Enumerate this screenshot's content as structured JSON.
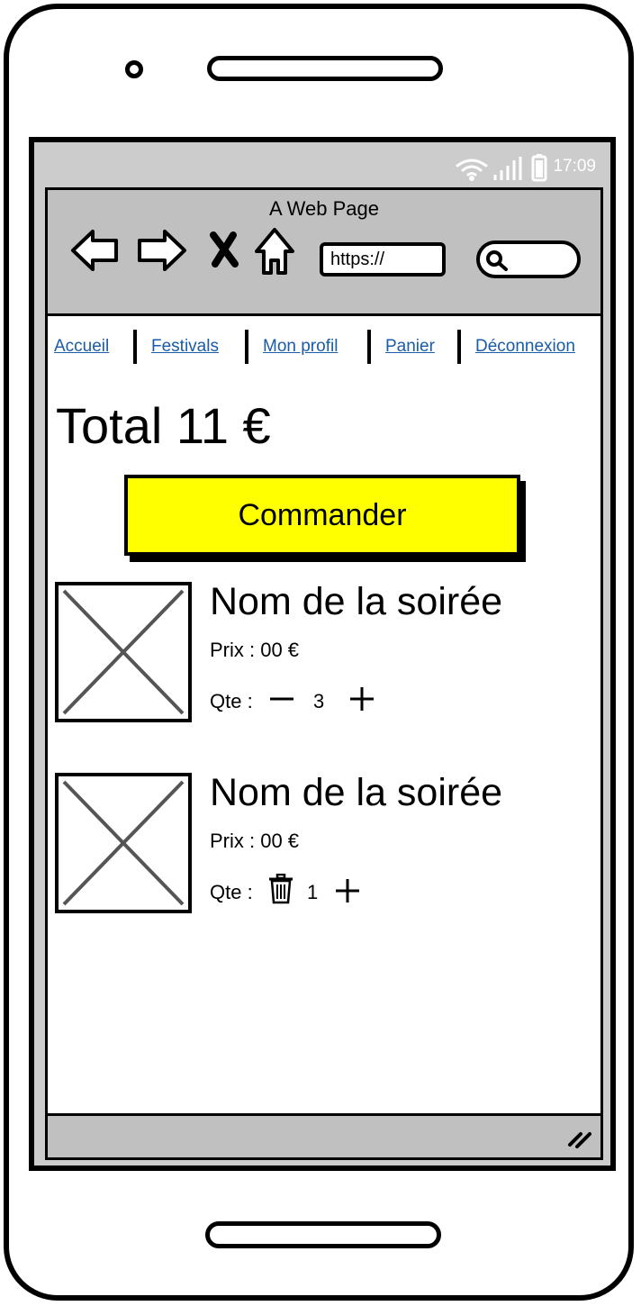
{
  "status_bar": {
    "time": "17:09",
    "icons": [
      "wifi-icon",
      "signal-icon",
      "battery-icon"
    ]
  },
  "browser": {
    "page_title": "A Web Page",
    "url": "https://",
    "icons": [
      "back-arrow-icon",
      "forward-arrow-icon",
      "stop-icon",
      "home-icon",
      "search-icon"
    ]
  },
  "nav": {
    "links": [
      "Accueil",
      "Festivals",
      "Mon profil",
      "Panier",
      "Déconnexion"
    ],
    "link_color": "#1a5ca8"
  },
  "cart": {
    "total_text": "Total 11 €",
    "order_button": "Commander",
    "order_button_color": "#ffff00",
    "items": [
      {
        "name": "Nom de la soirée",
        "price": "Prix : 00 €",
        "qte_label": "Qte :",
        "quantity": "3",
        "decrease_icon": "minus-icon",
        "increase_icon": "plus-icon"
      },
      {
        "name": "Nom de la soirée",
        "price": "Prix : 00 €",
        "qte_label": "Qte :",
        "quantity": "1",
        "decrease_icon": "trash-icon",
        "increase_icon": "plus-icon"
      }
    ]
  }
}
